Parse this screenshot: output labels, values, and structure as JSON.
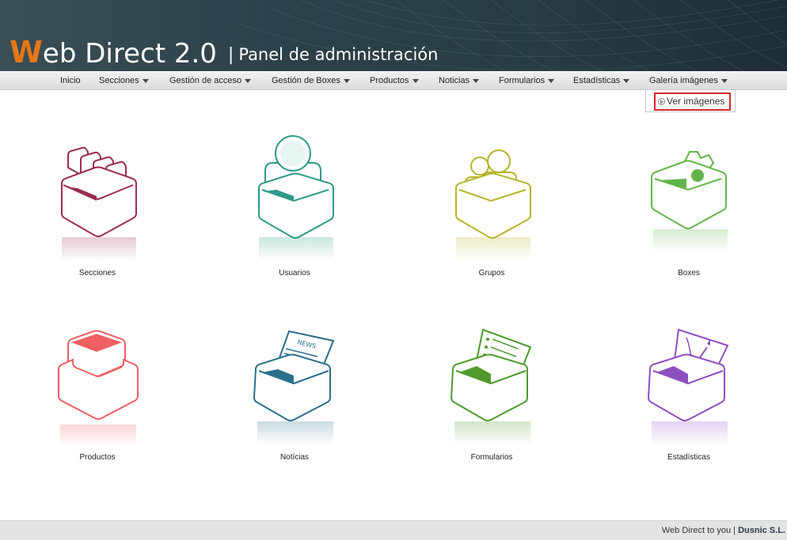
{
  "header": {
    "logo_initial": "W",
    "logo_rest": "eb Direct 2.0",
    "separator": "|",
    "subtitle": "Panel de administración"
  },
  "nav": {
    "items": [
      {
        "label": "Inicio",
        "has_dropdown": false
      },
      {
        "label": "Secciones",
        "has_dropdown": true
      },
      {
        "label": "Gestión de acceso",
        "has_dropdown": true
      },
      {
        "label": "Gestión de Boxes",
        "has_dropdown": true
      },
      {
        "label": "Productos",
        "has_dropdown": true
      },
      {
        "label": "Noticias",
        "has_dropdown": true
      },
      {
        "label": "Formularios",
        "has_dropdown": true
      },
      {
        "label": "Estadísticas",
        "has_dropdown": true
      },
      {
        "label": "Galería imágenes",
        "has_dropdown": true
      }
    ],
    "open_dropdown": {
      "parent": "Galería imágenes",
      "items": [
        {
          "label": "Ver imágenes",
          "icon": "circle-arrow-icon"
        }
      ]
    }
  },
  "tiles": [
    {
      "label": "Secciones",
      "icon": "folders-box-icon",
      "color": "#9b2d4f"
    },
    {
      "label": "Usuarios",
      "icon": "user-box-icon",
      "color": "#2e9a86"
    },
    {
      "label": "Grupos",
      "icon": "group-box-icon",
      "color": "#b5b42a"
    },
    {
      "label": "Boxes",
      "icon": "gear-box-icon",
      "color": "#62b54a"
    },
    {
      "label": "Productos",
      "icon": "product-box-icon",
      "color": "#ef5f62"
    },
    {
      "label": "Notícias",
      "icon": "news-box-icon",
      "color": "#2b6f8c",
      "badge": "NEWS"
    },
    {
      "label": "Formularios",
      "icon": "form-box-icon",
      "color": "#4e9a2c"
    },
    {
      "label": "Estadísticas",
      "icon": "stats-box-icon",
      "color": "#8e4fc0"
    }
  ],
  "footer": {
    "text": "Web Direct to you",
    "separator": "|",
    "company": "Dusnic S.L."
  }
}
